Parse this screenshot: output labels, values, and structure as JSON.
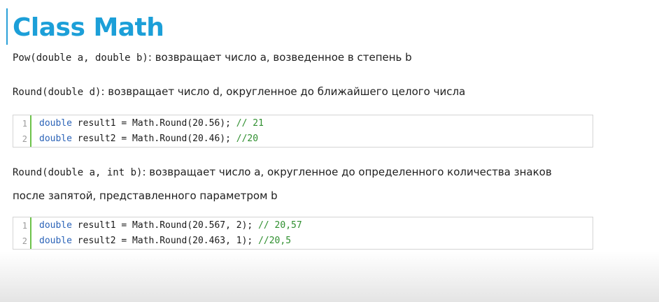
{
  "slide": {
    "title": "Class Math",
    "pow": {
      "signature": "Pow(double a, double b)",
      "description": ": возвращает число a, возведенное в степень b"
    },
    "round1": {
      "signature": "Round(double d)",
      "description": ": возвращает число d, округленное до ближайшего целого числа"
    },
    "code1": [
      {
        "num": "1",
        "keyword": "double",
        "code": " result1 = Math.Round(20.56); ",
        "comment": "// 21"
      },
      {
        "num": "2",
        "keyword": "double",
        "code": " result2 = Math.Round(20.46); ",
        "comment": "//20"
      }
    ],
    "round2": {
      "signature": "Round(double a, int b)",
      "description": ": возвращает число a, округленное до определенного количества знаков",
      "description_line2": "после запятой, представленного параметром b"
    },
    "code2": [
      {
        "num": "1",
        "keyword": "double",
        "code": " result1 = Math.Round(20.567, 2); ",
        "comment": "// 20,57"
      },
      {
        "num": "2",
        "keyword": "double",
        "code": " result2 = Math.Round(20.463, 1); ",
        "comment": "//20,5"
      }
    ]
  },
  "colors": {
    "title": "#1c9fd8",
    "keyword": "#2b63b8",
    "comment": "#2f8f2f",
    "gutter_border": "#6cc24a",
    "line_number": "#9a9a9a"
  }
}
